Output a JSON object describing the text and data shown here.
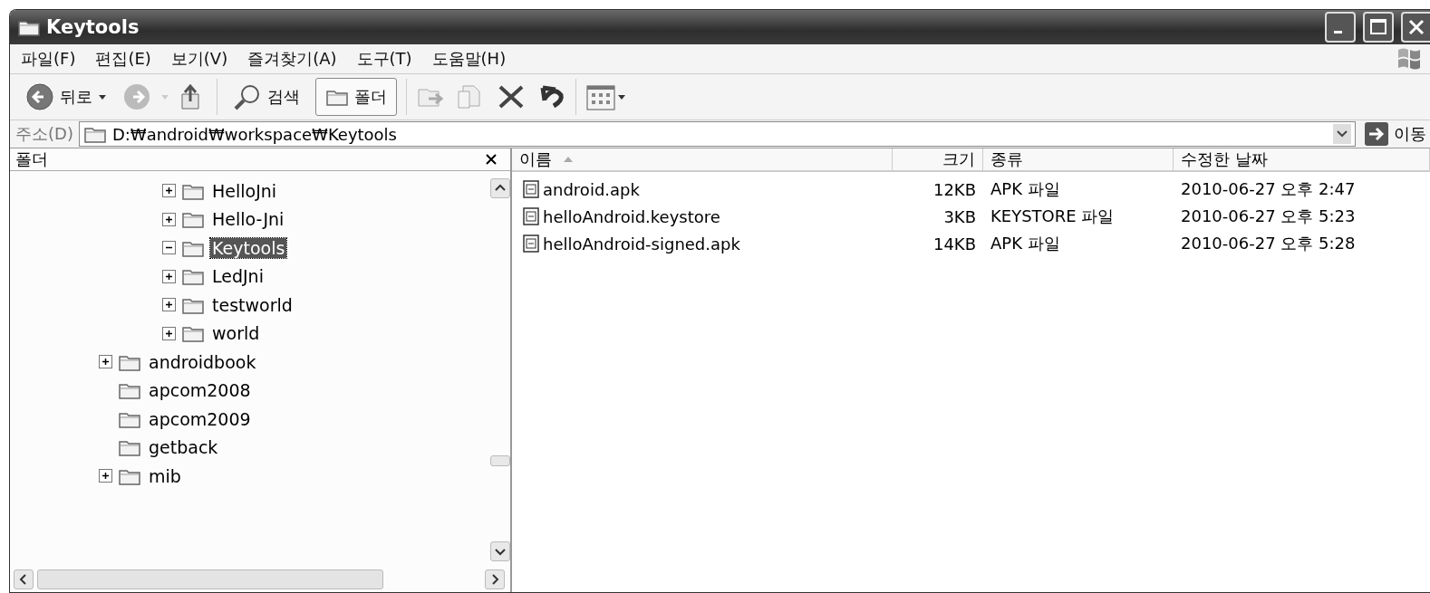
{
  "window": {
    "title": "Keytools"
  },
  "menu": [
    "파일(F)",
    "편집(E)",
    "보기(V)",
    "즐겨찾기(A)",
    "도구(T)",
    "도움말(H)"
  ],
  "toolbar": {
    "back": "뒤로",
    "search": "검색",
    "folders": {
      "label": "폴더",
      "selected": true
    }
  },
  "address": {
    "label": "주소(D)",
    "value": "D:₩android₩workspace₩Keytools",
    "go": "이동"
  },
  "folder_pane": {
    "title": "폴더",
    "items": [
      {
        "children": [
          {
            "label": "HelloJni",
            "expanded": false,
            "selected": false
          },
          {
            "label": "Hello-Jni",
            "expanded": false,
            "selected": false
          },
          {
            "label": "Keytools",
            "expanded": true,
            "selected": true
          },
          {
            "label": "LedJni",
            "expanded": false,
            "selected": false
          },
          {
            "label": "testworld",
            "expanded": false,
            "selected": false
          },
          {
            "label": "world",
            "expanded": false,
            "selected": false
          }
        ]
      },
      {
        "label": "androidbook",
        "expanded": false,
        "selected": false
      },
      {
        "label": "apcom2008",
        "selected": false
      },
      {
        "label": "apcom2009",
        "selected": false
      },
      {
        "label": "getback",
        "selected": false
      },
      {
        "label": "mib",
        "expanded": false,
        "selected": false
      }
    ]
  },
  "table": {
    "columns": [
      {
        "label": "이름",
        "sorted": true
      },
      {
        "label": "크기",
        "sorted": false
      },
      {
        "label": "종류",
        "sorted": false
      },
      {
        "label": "수정한 날짜",
        "sorted": false
      }
    ],
    "rows": [
      [
        "android.apk",
        "12KB",
        "APK 파일",
        "2010-06-27 오후 2:47"
      ],
      [
        "helloAndroid.keystore",
        "3KB",
        "KEYSTORE 파일",
        "2010-06-27 오후 5:23"
      ],
      [
        "helloAndroid-signed.apk",
        "14KB",
        "APK 파일",
        "2010-06-27 오후 5:28"
      ]
    ]
  }
}
